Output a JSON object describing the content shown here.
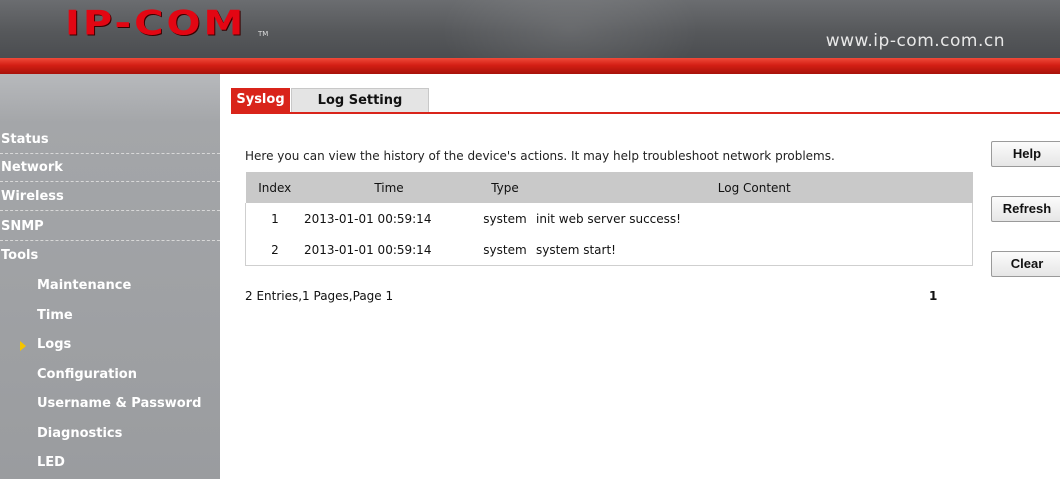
{
  "header": {
    "logo": "IP-COM",
    "url": "www.ip-com.com.cn"
  },
  "sidebar": {
    "items": [
      {
        "label": "Status"
      },
      {
        "label": "Network"
      },
      {
        "label": "Wireless"
      },
      {
        "label": "SNMP"
      },
      {
        "label": "Tools"
      }
    ],
    "tools_items": [
      {
        "label": "Maintenance"
      },
      {
        "label": "Time"
      },
      {
        "label": "Logs",
        "selected": true
      },
      {
        "label": "Configuration"
      },
      {
        "label": "Username & Password"
      },
      {
        "label": "Diagnostics"
      },
      {
        "label": "LED"
      }
    ]
  },
  "tabs": [
    {
      "label": "Syslog",
      "active": true
    },
    {
      "label": "Log Setting",
      "active": false
    }
  ],
  "main": {
    "description": "Here you can view the history of the device's actions. It may help troubleshoot network problems.",
    "table": {
      "headers": [
        "Index",
        "Time",
        "Type",
        "Log Content"
      ],
      "rows": [
        {
          "index": "1",
          "time": "2013-01-01 00:59:14",
          "type": "system",
          "content": "init web server success!"
        },
        {
          "index": "2",
          "time": "2013-01-01 00:59:14",
          "type": "system",
          "content": "system start!"
        }
      ]
    },
    "summary": "2 Entries,1 Pages,Page 1",
    "page_link": "1"
  },
  "buttons": {
    "help": "Help",
    "refresh": "Refresh",
    "clear": "Clear"
  },
  "colors": {
    "brand_red": "#d9241a",
    "header_gray": "#56585b",
    "sidebar_gray": "#a4a6a9",
    "arrow_yellow": "#f5c400"
  }
}
